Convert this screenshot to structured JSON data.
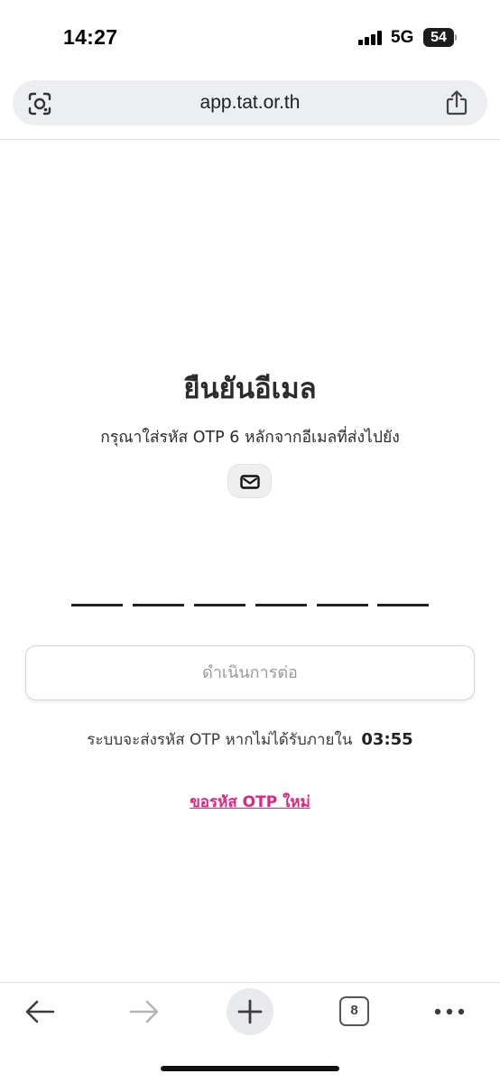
{
  "status_bar": {
    "time": "14:27",
    "network": "5G",
    "battery": "54",
    "icons": [
      "signal-icon",
      "battery-icon"
    ]
  },
  "browser": {
    "url": "app.tat.or.th",
    "icons": [
      "lens-icon",
      "share-icon"
    ]
  },
  "verify": {
    "title": "ยืนยันอีเมล",
    "subtitle": "กรุณาใส่รหัส OTP 6 หลักจากอีเมลที่ส่งไปยัง",
    "email_icon": "mail-icon",
    "otp_digits": [
      "",
      "",
      "",
      "",
      "",
      ""
    ],
    "continue_label": "ดำเนินการต่อ",
    "resend_info": "ระบบจะส่งรหัส OTP หากไม่ได้รับภายใน",
    "countdown": "03:55",
    "resend_link": "ขอรหัส OTP ใหม่"
  },
  "toolbar": {
    "tab_count": "8",
    "icons": [
      "back-arrow-icon",
      "forward-arrow-icon",
      "plus-icon",
      "tabs-icon",
      "more-icon"
    ]
  },
  "colors": {
    "accent_link": "#e0247f",
    "disabled_text": "#9a9a9a",
    "address_bar_bg": "#eceef1"
  }
}
